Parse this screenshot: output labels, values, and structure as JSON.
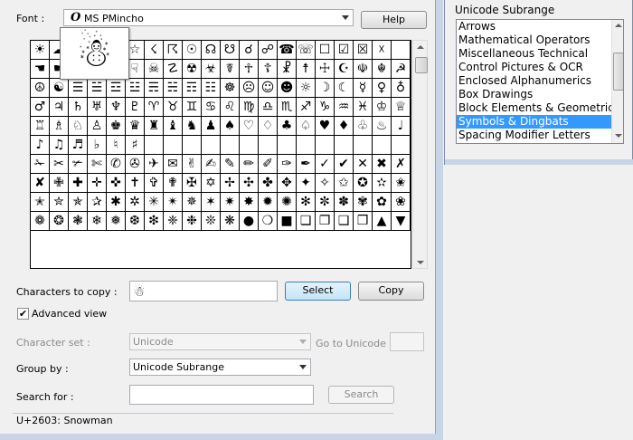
{
  "window": {
    "font_label": "Font :",
    "font_value": "MS PMincho",
    "font_icon": "opentype-font-icon",
    "help_label": "Help",
    "preview_char": "☃",
    "characters_to_copy_label": "Characters to copy :",
    "characters_to_copy_value": "☃",
    "select_label": "Select",
    "copy_label": "Copy",
    "advanced_view_label": "Advanced view",
    "advanced_view_checked": true,
    "character_set_label": "Character set :",
    "character_set_value": "Unicode",
    "go_to_unicode_label": "Go to Unicode :",
    "go_to_unicode_value": "",
    "group_by_label": "Group by :",
    "group_by_value": "Unicode Subrange",
    "search_for_label": "Search for :",
    "search_for_value": "",
    "search_label": "Search",
    "status_text": "U+2603: Snowman"
  },
  "grid": {
    "rows": [
      [
        "☀",
        "☁",
        "☂",
        "☃",
        "★",
        "☆",
        "☇",
        "☈",
        "☉",
        "☊",
        "☋",
        "☌",
        "☍",
        "☎",
        "☏",
        "☐",
        "☑",
        "☒",
        "☓",
        ""
      ],
      [
        "☚",
        "☛",
        "☜",
        "☝",
        "☞",
        "☟",
        "☠",
        "☡",
        "☢",
        "☣",
        "☤",
        "☥",
        "☦",
        "☧",
        "☨",
        "☩",
        "☪",
        "☫",
        "☬",
        "☭"
      ],
      [
        "☮",
        "☯",
        "☰",
        "☱",
        "☲",
        "☳",
        "☴",
        "☵",
        "☶",
        "☷",
        "☸",
        "☹",
        "☺",
        "☻",
        "☼",
        "☽",
        "☾",
        "☿",
        "♀",
        "♁"
      ],
      [
        "♂",
        "♃",
        "♄",
        "♅",
        "♆",
        "♇",
        "♈",
        "♉",
        "♊",
        "♋",
        "♌",
        "♍",
        "♎",
        "♏",
        "♐",
        "♑",
        "♒",
        "♓",
        "♔",
        "♕"
      ],
      [
        "♖",
        "♗",
        "♘",
        "♙",
        "♚",
        "♛",
        "♜",
        "♝",
        "♞",
        "♟",
        "♠",
        "♡",
        "♢",
        "♣",
        "♤",
        "♥",
        "♦",
        "♧",
        "♨",
        "♩"
      ],
      [
        "♪",
        "♫",
        "♬",
        "♭",
        "♮",
        "♯",
        "",
        "",
        "",
        "",
        "",
        "",
        "",
        "",
        "",
        "",
        "",
        "",
        "",
        ""
      ],
      [
        "✁",
        "✂",
        "✃",
        "✄",
        "✆",
        "✇",
        "✈",
        "✉",
        "✌",
        "✍",
        "✎",
        "✏",
        "✐",
        "✑",
        "✒",
        "✓",
        "✔",
        "✕",
        "✖",
        "✗"
      ],
      [
        "✘",
        "✙",
        "✚",
        "✛",
        "✜",
        "✝",
        "✞",
        "✟",
        "✠",
        "✡",
        "✢",
        "✣",
        "✤",
        "✥",
        "✦",
        "✧",
        "✩",
        "✪",
        "✫",
        "✬"
      ],
      [
        "✭",
        "✮",
        "✯",
        "✰",
        "✱",
        "✲",
        "✳",
        "✴",
        "✵",
        "✶",
        "✷",
        "✸",
        "✹",
        "✺",
        "✻",
        "✼",
        "✽",
        "✾",
        "✿",
        "❀"
      ],
      [
        "❁",
        "❂",
        "❃",
        "❄",
        "❅",
        "❆",
        "❇",
        "❈",
        "❉",
        "❊",
        "❋",
        "●",
        "❍",
        "■",
        "❏",
        "❐",
        "❑",
        "❒",
        "▲",
        "▼"
      ]
    ]
  },
  "subrange_window": {
    "title": "Unicode Subrange",
    "items": [
      "Arrows",
      "Mathematical Operators",
      "Miscellaneous Technical",
      "Control Pictures & OCR",
      "Enclosed Alphanumerics",
      "Box Drawings",
      "Block Elements & Geometric Shapes",
      "Symbols & Dingbats",
      "Spacing Modifier Letters"
    ],
    "selected": "Symbols & Dingbats"
  },
  "colors": {
    "selection": "#3399ff",
    "focus_border": "#3c7fb1",
    "frame_blue": "#c8d5e6"
  }
}
